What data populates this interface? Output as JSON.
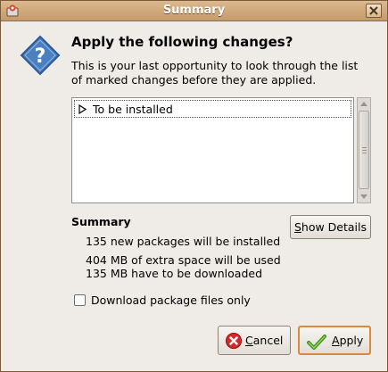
{
  "window": {
    "title": "Summary"
  },
  "dialog": {
    "heading": "Apply the following changes?",
    "subtext": "This is your last opportunity to look through the list of marked changes before they are applied."
  },
  "changes_list": {
    "rows": [
      {
        "label": "To be installed",
        "expanded": false
      }
    ]
  },
  "summary": {
    "title": "Summary",
    "new_packages": "135 new packages will be installed",
    "extra_space": "404 MB of extra space will be used",
    "download": "135 MB have to be downloaded"
  },
  "buttons": {
    "show_details": {
      "mnemonic": "S",
      "rest": "how Details"
    },
    "cancel": {
      "mnemonic": "C",
      "rest": "ancel"
    },
    "apply": {
      "mnemonic": "A",
      "rest": "pply"
    }
  },
  "options": {
    "download_only": {
      "label": "Download package files only",
      "checked": false
    }
  },
  "colors": {
    "titlebar": "#c49a6a",
    "dialog_bg": "#efebe7",
    "default_button_border": "#d98a3c",
    "dialog_icon": "#4a7fc0"
  },
  "icons": {
    "dialog": "question-icon",
    "cancel": "cancel-icon",
    "apply": "checkmark-icon"
  }
}
